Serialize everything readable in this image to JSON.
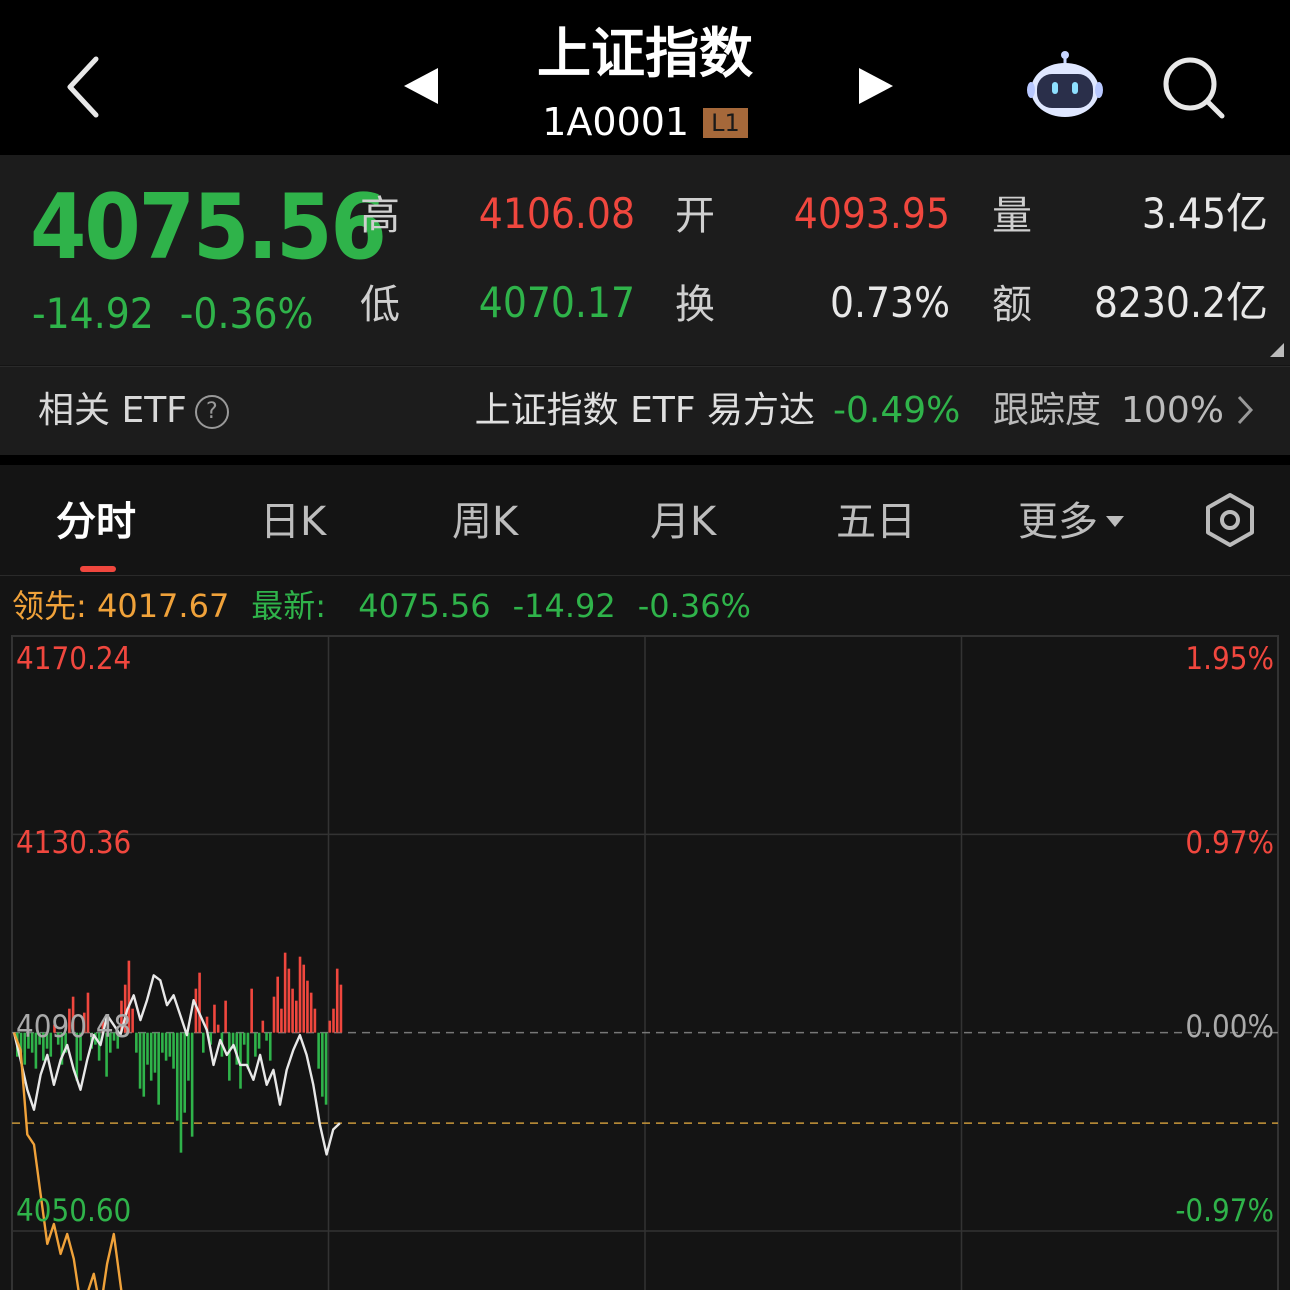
{
  "header": {
    "title": "上证指数",
    "code": "1A0001",
    "level_badge": "L1"
  },
  "quote": {
    "price": "4075.56",
    "change": "-14.92",
    "change_pct": "-0.36%",
    "high_label": "高",
    "high": "4106.08",
    "low_label": "低",
    "low": "4070.17",
    "open_label": "开",
    "open": "4093.95",
    "turnover_label": "换",
    "turnover": "0.73%",
    "volume_label": "量",
    "volume": "3.45亿",
    "amount_label": "额",
    "amount": "8230.2亿"
  },
  "etf": {
    "label": "相关 ETF",
    "help_glyph": "?",
    "name": "上证指数 ETF 易方达",
    "change_pct": "-0.49%",
    "tracking_label": "跟踪度",
    "tracking_value": "100%"
  },
  "tabs": [
    {
      "label": "分时",
      "active": true
    },
    {
      "label": "日K"
    },
    {
      "label": "周K"
    },
    {
      "label": "月K"
    },
    {
      "label": "五日"
    },
    {
      "label": "更多"
    }
  ],
  "legend": {
    "lead_label": "领先:",
    "lead_value": "4017.67",
    "latest_label": "最新:",
    "latest_value": "4075.56",
    "latest_change": "-14.92",
    "latest_pct": "-0.36%"
  },
  "chart_data": {
    "type": "line",
    "y_left_ticks": [
      "4170.24",
      "4130.36",
      "4090.48",
      "4050.60"
    ],
    "y_right_ticks": [
      "1.95%",
      "0.97%",
      "0.00%",
      "-0.97%"
    ],
    "ylim": [
      4050.6,
      4170.24
    ],
    "prev_close": 4090.48,
    "avg_reference": 4072.3,
    "series": [
      {
        "color": "#e8e8e8",
        "values": [
          4090.5,
          4085,
          4079,
          4075,
          4082,
          4086,
          4080,
          4085,
          4088,
          4083,
          4079,
          4085,
          4090,
          4088,
          4094,
          4092,
          4090,
          4095,
          4098,
          4093,
          4097,
          4102,
          4101,
          4096,
          4098,
          4094,
          4090,
          4097,
          4094,
          4091,
          4084,
          4089,
          4086,
          4088,
          4084,
          4084,
          4081,
          4086,
          4080,
          4083,
          4076,
          4083,
          4087,
          4090,
          4086,
          4080,
          4072,
          4066,
          4071,
          4072.3
        ]
      },
      {
        "color": "#f0a23a",
        "values": [
          4090.5,
          4087,
          4070,
          4068,
          4058,
          4048,
          4052,
          4046,
          4050,
          4045,
          4036,
          4038,
          4042,
          4035,
          4044,
          4050,
          4040,
          4030
        ]
      }
    ],
    "volume_bars": [
      -6,
      -5,
      -8,
      -4,
      -5,
      -9,
      -3,
      -7,
      -4,
      -6,
      2,
      -3,
      -8,
      -5,
      6,
      9,
      -12,
      -7,
      5,
      10,
      -4,
      -3,
      -7,
      3,
      -11,
      -5,
      -2,
      -4,
      8,
      12,
      18,
      6,
      -5,
      -14,
      -16,
      -8,
      -12,
      -10,
      -18,
      -5,
      -7,
      -6,
      -9,
      -22,
      -30,
      -20,
      -12,
      -26,
      11,
      15,
      -5,
      4,
      -3,
      7,
      2,
      -6,
      8,
      -12,
      -4,
      -8,
      -14,
      -3,
      -9,
      11,
      -6,
      -4,
      3,
      -2,
      -7,
      9,
      14,
      6,
      20,
      16,
      11,
      8,
      19,
      17,
      13,
      10,
      6,
      -9,
      -16,
      -18,
      3,
      6,
      16,
      12
    ]
  }
}
